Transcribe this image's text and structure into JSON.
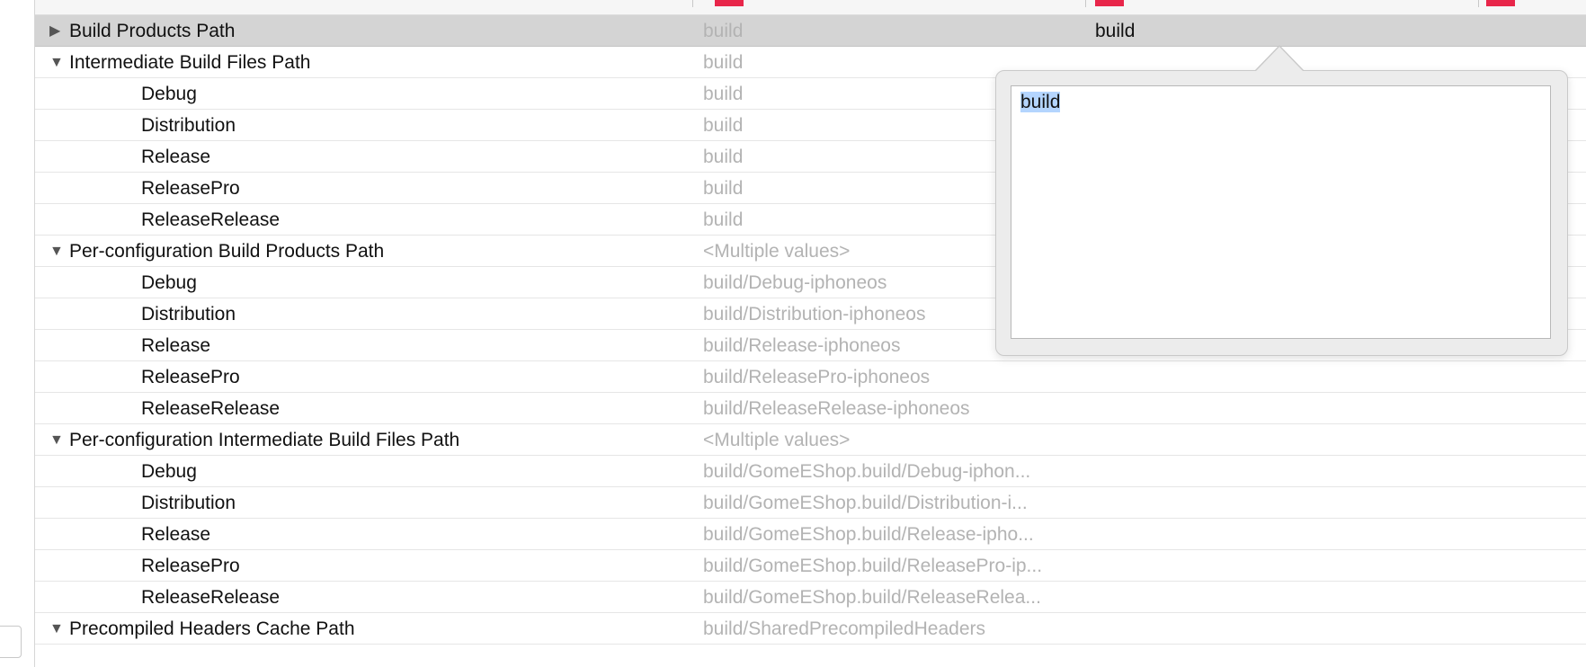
{
  "rows": [
    {
      "kind": "group",
      "expanded": false,
      "selected": true,
      "name": "Build Products Path",
      "value": "build",
      "value2": "build"
    },
    {
      "kind": "group",
      "expanded": true,
      "name": "Intermediate Build Files Path",
      "value": "build"
    },
    {
      "kind": "child",
      "name": "Debug",
      "value": "build"
    },
    {
      "kind": "child",
      "name": "Distribution",
      "value": "build"
    },
    {
      "kind": "child",
      "name": "Release",
      "value": "build"
    },
    {
      "kind": "child",
      "name": "ReleasePro",
      "value": "build"
    },
    {
      "kind": "child",
      "name": "ReleaseRelease",
      "value": "build"
    },
    {
      "kind": "group",
      "expanded": true,
      "name": "Per-configuration Build Products Path",
      "value": "<Multiple values>"
    },
    {
      "kind": "child",
      "name": "Debug",
      "value": "build/Debug-iphoneos"
    },
    {
      "kind": "child",
      "name": "Distribution",
      "value": "build/Distribution-iphoneos"
    },
    {
      "kind": "child",
      "name": "Release",
      "value": "build/Release-iphoneos"
    },
    {
      "kind": "child",
      "name": "ReleasePro",
      "value": "build/ReleasePro-iphoneos"
    },
    {
      "kind": "child",
      "name": "ReleaseRelease",
      "value": "build/ReleaseRelease-iphoneos"
    },
    {
      "kind": "group",
      "expanded": true,
      "name": "Per-configuration Intermediate Build Files Path",
      "value": "<Multiple values>"
    },
    {
      "kind": "child",
      "name": "Debug",
      "value": "build/GomeEShop.build/Debug-iphon..."
    },
    {
      "kind": "child",
      "name": "Distribution",
      "value": "build/GomeEShop.build/Distribution-i..."
    },
    {
      "kind": "child",
      "name": "Release",
      "value": "build/GomeEShop.build/Release-ipho..."
    },
    {
      "kind": "child",
      "name": "ReleasePro",
      "value": "build/GomeEShop.build/ReleasePro-ip..."
    },
    {
      "kind": "child",
      "name": "ReleaseRelease",
      "value": "build/GomeEShop.build/ReleaseRelea..."
    },
    {
      "kind": "group",
      "expanded": true,
      "name": "Precompiled Headers Cache Path",
      "value": "build/SharedPrecompiledHeaders"
    }
  ],
  "popover": {
    "editor_text": "build"
  },
  "icons": {
    "collapsed": "▶",
    "expanded": "▼"
  },
  "colors": {
    "header_swatch": "#e8264a",
    "selection_row": "#d4d4d4",
    "text_selection": "#b4d5fe"
  }
}
